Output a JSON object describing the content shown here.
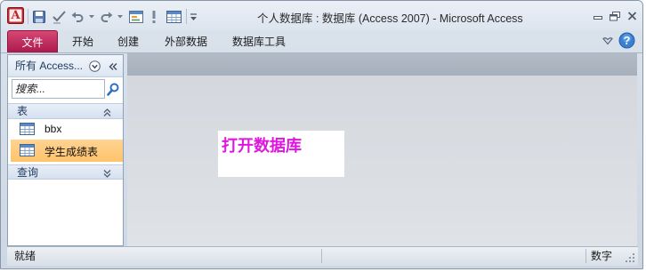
{
  "window": {
    "app_icon_letter": "A",
    "title": "个人数据库 : 数据库 (Access 2007) - Microsoft Access",
    "controls": [
      "minimize-icon",
      "restore-icon",
      "close-icon"
    ]
  },
  "quick_access_toolbar": {
    "icons": [
      "save-icon",
      "edit-icon",
      "undo-icon",
      "redo-icon",
      "form-icon",
      "run-icon",
      "table-icon",
      "customize-icon"
    ]
  },
  "ribbon": {
    "tabs": [
      {
        "label": "文件",
        "active": true
      },
      {
        "label": "开始",
        "active": false
      },
      {
        "label": "创建",
        "active": false
      },
      {
        "label": "外部数据",
        "active": false
      },
      {
        "label": "数据库工具",
        "active": false
      }
    ],
    "help_glyph": "?"
  },
  "nav_pane": {
    "title": "所有 Access...",
    "search_placeholder": "搜索...",
    "groups": [
      {
        "label": "表",
        "expanded": true,
        "items": [
          {
            "label": "bbx",
            "icon": "table-icon",
            "selected": false
          },
          {
            "label": "学生成绩表",
            "icon": "table-icon",
            "selected": true
          }
        ]
      },
      {
        "label": "查询",
        "expanded": false,
        "items": []
      }
    ]
  },
  "main": {
    "label_text": "打开数据库"
  },
  "status_bar": {
    "left": "就绪",
    "right": "数字"
  },
  "colors": {
    "file_tab": "#a91749",
    "selected_item": "#ffc36a",
    "label_text": "#df16df",
    "nav_text": "#1e395b",
    "app_icon": "#c0272d"
  }
}
